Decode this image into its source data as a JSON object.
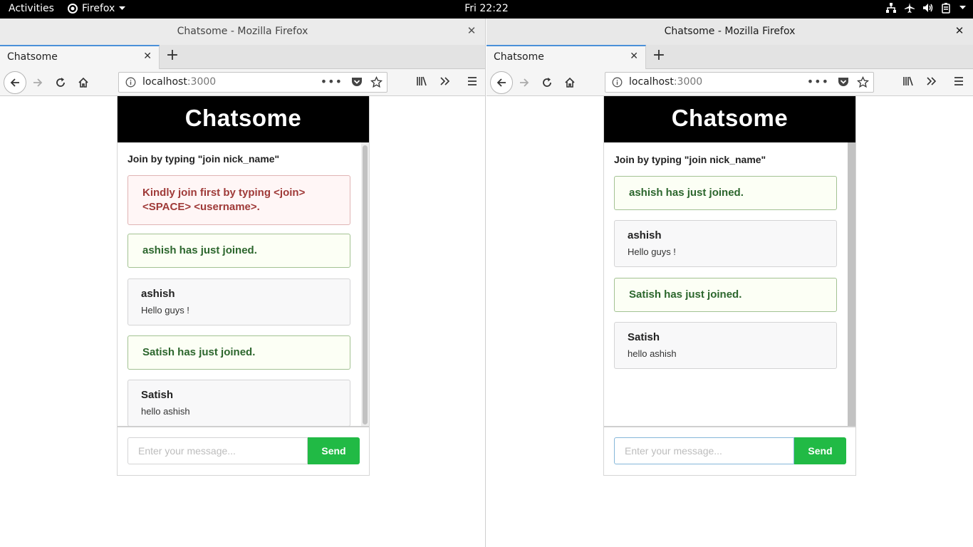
{
  "topbar": {
    "activities": "Activities",
    "app_name": "Firefox",
    "clock": "Fri 22:22"
  },
  "windows": {
    "left": {
      "title": "Chatsome - Mozilla Firefox",
      "tab_label": "Chatsome",
      "url_host": "localhost",
      "url_port": ":3000",
      "chat": {
        "header": "Chatsome",
        "hint": "Join by typing \"join nick_name\"",
        "error": "Kindly join first by typing <join> <SPACE> <username>.",
        "joined1": "ashish has just joined.",
        "msg1": {
          "user": "ashish",
          "text": "Hello guys !"
        },
        "joined2": "Satish has just joined.",
        "msg2": {
          "user": "Satish",
          "text": "hello ashish"
        },
        "placeholder": "Enter your message...",
        "send_label": "Send"
      }
    },
    "right": {
      "title": "Chatsome - Mozilla Firefox",
      "tab_label": "Chatsome",
      "url_host": "localhost",
      "url_port": ":3000",
      "chat": {
        "header": "Chatsome",
        "hint": "Join by typing \"join nick_name\"",
        "joined1": "ashish has just joined.",
        "msg1": {
          "user": "ashish",
          "text": "Hello guys !"
        },
        "joined2": "Satish has just joined.",
        "msg2": {
          "user": "Satish",
          "text": "hello ashish"
        },
        "placeholder": "Enter your message...",
        "send_label": "Send"
      }
    }
  },
  "colors": {
    "send_button": "#21ba45",
    "error_text": "#9f3a38",
    "joined_text": "#2c662d",
    "tab_accent": "#4a90d9"
  }
}
